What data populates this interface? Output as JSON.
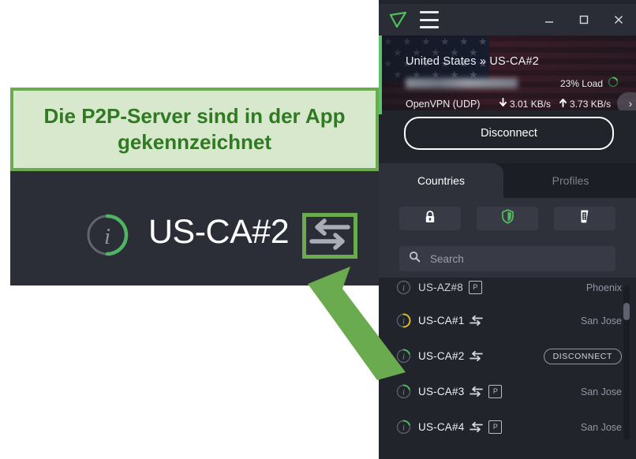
{
  "note": {
    "text": "Die P2P-Server sind in der App gekennzeichnet",
    "box_fill": "#d8e8cc",
    "box_border": "#6aab4f",
    "text_color": "#2f7a22"
  },
  "callout": {
    "server_label": "US-CA#2",
    "info_icon": "info-icon",
    "p2p_icon": "p2p-arrows-icon",
    "highlight_color": "#6aab4f",
    "panel_bg": "#2b2e37"
  },
  "arrow": {
    "name": "green-pointer-arrow",
    "color": "#6aab4f"
  },
  "app": {
    "titlebar": {
      "logo_icon": "vpn-logo-icon",
      "menu_icon": "hamburger-menu-icon",
      "minimize_icon": "minimize-icon",
      "maximize_icon": "maximize-icon",
      "close_icon": "close-icon"
    },
    "banner": {
      "server_title": "United States » US-CA#2",
      "ip_address": "",
      "load_label": "23% Load",
      "load_percent": 23,
      "protocol": "OpenVPN (UDP)",
      "download_speed": "3.01 KB/s",
      "upload_speed": "3.73 KB/s",
      "download_icon": "arrow-down-icon",
      "upload_icon": "arrow-up-icon",
      "next_icon": "chevron-right-icon",
      "load_ring_icon": "load-ring-icon"
    },
    "disconnect_button": "Disconnect",
    "tabs": [
      {
        "label": "Countries",
        "active": true
      },
      {
        "label": "Profiles",
        "active": false
      }
    ],
    "icon_buttons": [
      {
        "name": "lock-icon",
        "label": "lock"
      },
      {
        "name": "shield-icon",
        "label": "shield"
      },
      {
        "name": "streaming-icon",
        "label": "streaming"
      }
    ],
    "search": {
      "placeholder": "Search",
      "value": "",
      "icon": "search-icon"
    },
    "server_list": [
      {
        "name": "US-AZ#8",
        "location": "Phoenix",
        "p2p": false,
        "port_forward": true,
        "connected": false,
        "load_color": "#7a7f8c",
        "cut_off": true
      },
      {
        "name": "US-CA#1",
        "location": "San Jose",
        "p2p": true,
        "port_forward": false,
        "connected": false,
        "load_color": "#d9b72a",
        "cut_off": false
      },
      {
        "name": "US-CA#2",
        "location": "DISCONNECT",
        "p2p": true,
        "port_forward": false,
        "connected": true,
        "load_color": "#4fb560",
        "cut_off": false
      },
      {
        "name": "US-CA#3",
        "location": "San Jose",
        "p2p": true,
        "port_forward": true,
        "connected": false,
        "load_color": "#4fb560",
        "cut_off": false
      },
      {
        "name": "US-CA#4",
        "location": "San Jose",
        "p2p": true,
        "port_forward": true,
        "connected": false,
        "load_color": "#4fb560",
        "cut_off": false
      }
    ],
    "port_forward_badge": "P",
    "scrollbar": "list-scrollbar"
  }
}
